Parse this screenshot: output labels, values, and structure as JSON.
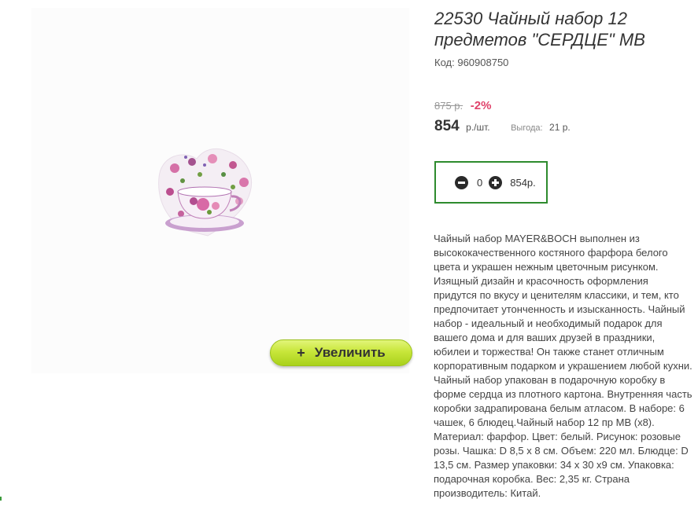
{
  "product": {
    "title": "22530 Чайный набор 12 предметов \"СЕРДЦЕ\" MB",
    "code_label": "Код:",
    "code": "960908750",
    "old_price": "875 р.",
    "discount": "-2%",
    "price": "854",
    "price_unit": "р./шт.",
    "benefit_label": "Выгода:",
    "benefit_value": "21 р.",
    "description": "Чайный набор MAYER&BOCH выполнен из высококачественного костяного фарфора белого цвета и украшен нежным цветочным рисунком. Изящный дизайн и красочность оформления придутся по вкусу и ценителям классики, и тем, кто предпочитает утонченность и изысканность. Чайный набор - идеальный и необходимый подарок для вашего дома и для ваших друзей в праздники, юбилеи и торжества! Он также станет отличным корпоративным подарком и украшением любой кухни. Чайный набор упакован в подарочную коробку в форме сердца из плотного картона. Внутренняя часть коробки задрапирована белым атласом. В наборе: 6 чашек, 6 блюдец.Чайный набор 12 пр MB (x8). Материал: фарфор. Цвет: белый. Рисунок: розовые розы. Чашка: D 8,5 x 8 см. Объем: 220 мл. Блюдце: D 13,5 см. Размер упаковки: 34 x 30 x9 см. Упаковка: подарочная коробка. Вес: 2,35 кг. Страна производитель: Китай."
  },
  "gallery": {
    "zoom_plus": "+",
    "zoom_label": "Увеличить"
  },
  "cart": {
    "minus_icon": "minus-circle-icon",
    "plus_icon": "plus-circle-icon",
    "quantity": "0",
    "line_total": "854р."
  },
  "colors": {
    "discount": "#e0426a",
    "cart_border": "#2e8b2e",
    "zoom_button": "#c8e63a"
  }
}
